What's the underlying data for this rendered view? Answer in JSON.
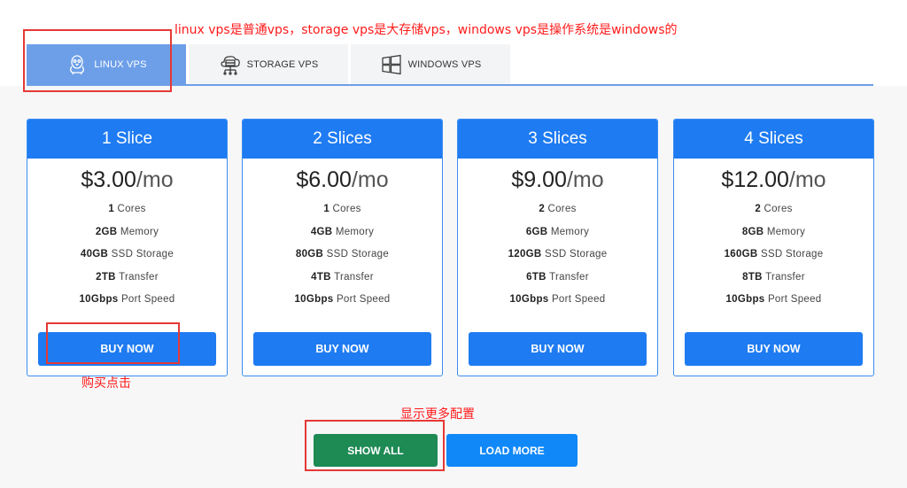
{
  "annotations": {
    "top": "linux vps是普通vps，storage vps是大存储vps，windows vps是操作系统是windows的",
    "buy": "购买点击",
    "more": "显示更多配置"
  },
  "tabs": [
    {
      "label": "LINUX VPS",
      "icon": "penguin-icon",
      "active": true
    },
    {
      "label": "STORAGE VPS",
      "icon": "server-cloud-icon",
      "active": false
    },
    {
      "label": "WINDOWS VPS",
      "icon": "windows-icon",
      "active": false
    }
  ],
  "plans": [
    {
      "name": "1 Slice",
      "price": "$3.00",
      "period": "/mo",
      "specs": [
        {
          "v": "1",
          "l": " Cores"
        },
        {
          "v": "2GB",
          "l": " Memory"
        },
        {
          "v": "40GB",
          "l": " SSD Storage"
        },
        {
          "v": "2TB",
          "l": " Transfer"
        },
        {
          "v": "10Gbps",
          "l": " Port Speed"
        }
      ],
      "button": "BUY NOW"
    },
    {
      "name": "2 Slices",
      "price": "$6.00",
      "period": "/mo",
      "specs": [
        {
          "v": "1",
          "l": " Cores"
        },
        {
          "v": "4GB",
          "l": " Memory"
        },
        {
          "v": "80GB",
          "l": " SSD Storage"
        },
        {
          "v": "4TB",
          "l": " Transfer"
        },
        {
          "v": "10Gbps",
          "l": " Port Speed"
        }
      ],
      "button": "BUY NOW"
    },
    {
      "name": "3 Slices",
      "price": "$9.00",
      "period": "/mo",
      "specs": [
        {
          "v": "2",
          "l": " Cores"
        },
        {
          "v": "6GB",
          "l": " Memory"
        },
        {
          "v": "120GB",
          "l": " SSD Storage"
        },
        {
          "v": "6TB",
          "l": " Transfer"
        },
        {
          "v": "10Gbps",
          "l": " Port Speed"
        }
      ],
      "button": "BUY NOW"
    },
    {
      "name": "4 Slices",
      "price": "$12.00",
      "period": "/mo",
      "specs": [
        {
          "v": "2",
          "l": " Cores"
        },
        {
          "v": "8GB",
          "l": " Memory"
        },
        {
          "v": "160GB",
          "l": " SSD Storage"
        },
        {
          "v": "8TB",
          "l": " Transfer"
        },
        {
          "v": "10Gbps",
          "l": " Port Speed"
        }
      ],
      "button": "BUY NOW"
    }
  ],
  "actions": {
    "show_all": "SHOW ALL",
    "load_more": "LOAD MORE"
  },
  "colors": {
    "accent": "#1e7bf2",
    "tab_active": "#6d9fe8",
    "show_all": "#1e8a54",
    "load_more": "#1088f7",
    "annotation": "#ff1a1a"
  }
}
